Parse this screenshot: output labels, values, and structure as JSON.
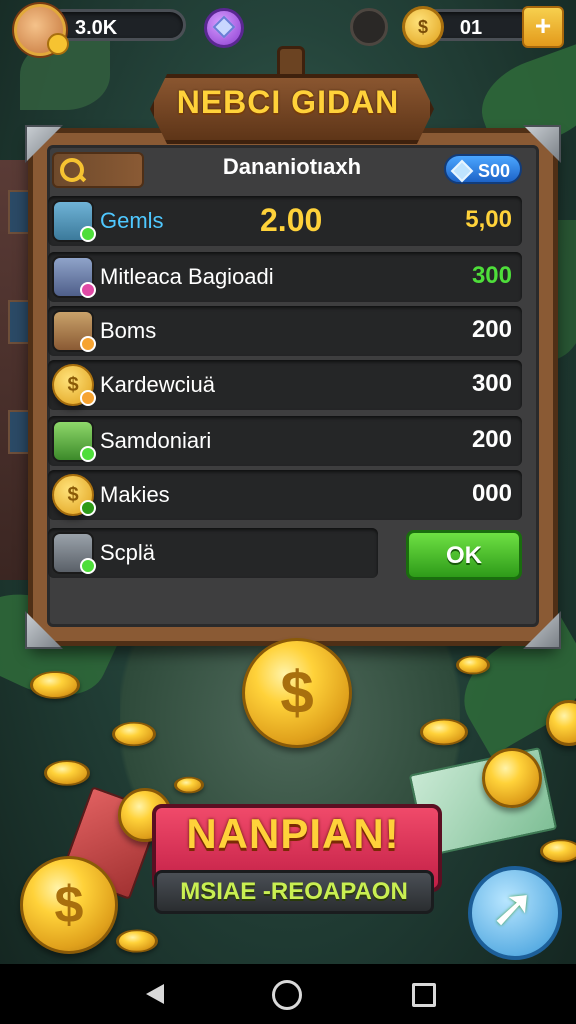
{
  "top_bar": {
    "coin_balance": "3.0K",
    "counter_value": "01",
    "plus_label": "+"
  },
  "banner": {
    "title": "NEBCI GIDAN"
  },
  "panel": {
    "title": "Dananiotıaxh",
    "gem_value": "S00",
    "rows": [
      {
        "name": "Gemls",
        "mid": "2.00",
        "value": "5,00",
        "value_color": "#ffd23a",
        "icon": "gem-chest-icon"
      },
      {
        "name": "Mitleaca Bagioadi",
        "value": "300",
        "value_color": "#4ede3a",
        "icon": "treasure-box-icon"
      },
      {
        "name": "Boms",
        "value": "200",
        "value_color": "#ffffff",
        "icon": "bomb-crate-icon"
      },
      {
        "name": "Kardewciuä",
        "value": "300",
        "value_color": "#ffffff",
        "icon": "coin-icon"
      },
      {
        "name": "Samdoniari",
        "value": "200",
        "value_color": "#ffffff",
        "icon": "green-chest-icon"
      },
      {
        "name": "Makies",
        "value": "000",
        "value_color": "#ffffff",
        "icon": "coin-icon"
      },
      {
        "name": "Scplä",
        "icon": "chest-icon"
      }
    ],
    "ok_label": "OK"
  },
  "promo": {
    "title": "NANPIAN!",
    "subtitle": "MSIAE -REOAPAON"
  },
  "coin_symbol": "$",
  "colors": {
    "gold": "#ffd23a",
    "ok_green": "#2e9b19",
    "panel_wood": "#8a5a34"
  }
}
